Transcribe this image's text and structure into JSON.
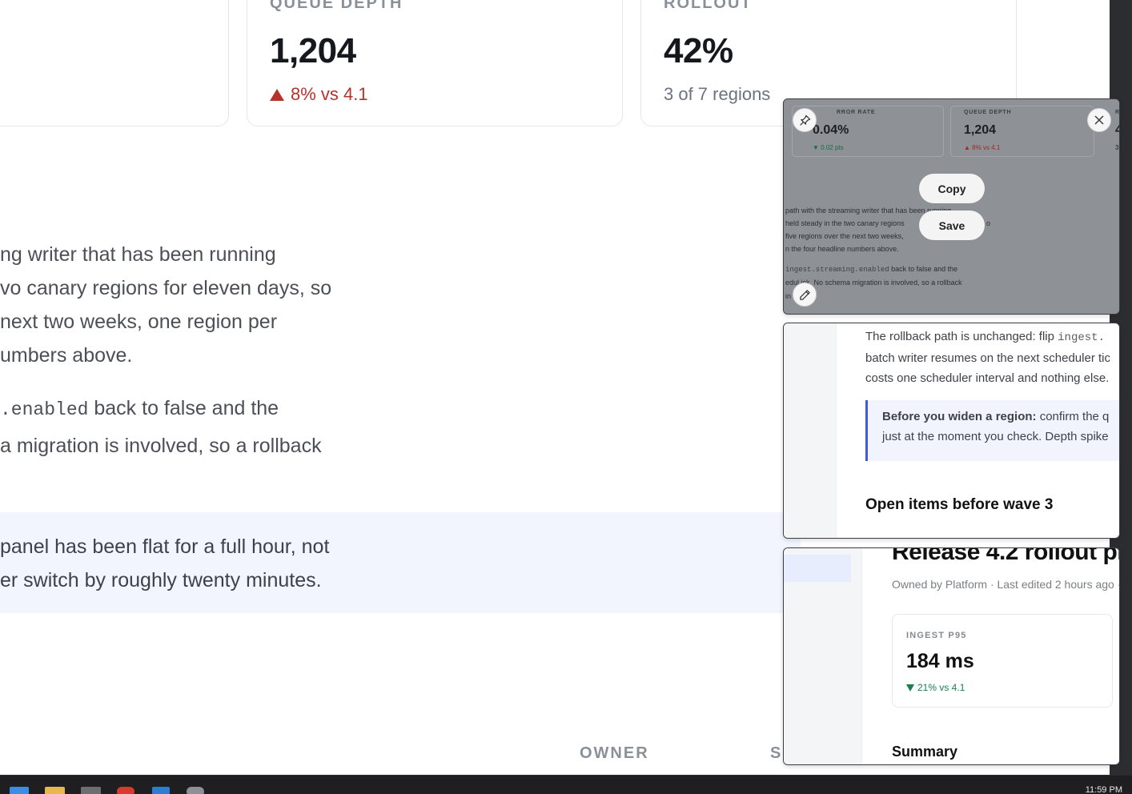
{
  "kpis": [
    {
      "label": "QUEUE DEPTH",
      "value": "1,204",
      "delta": "8% vs 4.1",
      "trend": "up-bad"
    },
    {
      "label": "ROLLOUT",
      "value": "42%",
      "delta": "3 of 7 regions",
      "trend": "neutral"
    }
  ],
  "body": {
    "lines": [
      "ng writer that has been running",
      "vo canary regions for eleven days, so",
      "next two weeks, one region per",
      "umbers above."
    ],
    "rollback_code": ".enabled",
    "rollback_line1_rest": " back to false and the",
    "rollback_line2": "a migration is involved, so a rollback",
    "callout_line1": "panel has been flat for a full hour, not",
    "callout_line2": "er switch by roughly twenty minutes."
  },
  "table": {
    "col_owner": "OWNER",
    "col_status_partial": "S"
  },
  "snip_overlay": {
    "mini_kpi_1_label": "RROR RATE",
    "mini_kpi_1_value": "0.04%",
    "mini_kpi_1_delta": "0.02 pts",
    "mini_kpi_2_label": "QUEUE DEPTH",
    "mini_kpi_2_value": "1,204",
    "mini_kpi_2_delta": "8% vs 4.1",
    "mini_kpi_3_label": "R",
    "mini_kpi_3_value": "4",
    "mini_kpi_3_delta": "3",
    "mini_lines": [
      "path with the streaming writer that has been running",
      "held steady in the two canary regions",
      "five regions over the next two weeks,",
      "n the four headline numbers above."
    ],
    "mini_line_right_1": "o",
    "mini_code": "ingest.streaming.enabled",
    "mini_code_rest": " back to false and the",
    "mini_line_last": "edul ick. No schema migration is involved, so a rollback",
    "mini_line_tail": "in",
    "copy_label": "Copy",
    "save_label": "Save"
  },
  "panel_two": {
    "line1_text": "The rollback path is unchanged: flip ",
    "line1_code": "ingest.",
    "line2": "batch writer resumes on the next scheduler tic",
    "line3": "costs one scheduler interval and nothing else.",
    "callout_bold": "Before you widen a region:",
    "callout_rest": " confirm the q",
    "callout_line2": "just at the moment you check. Depth spike",
    "heading": "Open items before wave 3"
  },
  "panel_three": {
    "title": "Release 4.2 rollout pl",
    "meta": "Owned by Platform · Last edited 2 hours ago ·",
    "card_label": "INGEST P95",
    "card_value": "184 ms",
    "card_delta": "21% vs 4.1",
    "summary": "Summary"
  },
  "taskbar": {
    "clock": "11:59 PM"
  },
  "colors": {
    "bad": "#b5332b",
    "good": "#1b7f4c",
    "accent": "#3d5bd9",
    "callout_bg": "#f3f5fe"
  }
}
